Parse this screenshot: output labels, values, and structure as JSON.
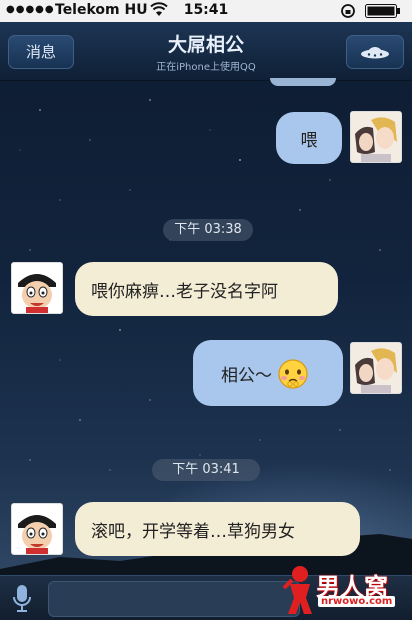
{
  "status_bar": {
    "signal": "●●●●●",
    "carrier": "Telekom HU",
    "time": "15:41"
  },
  "nav": {
    "back_label": "消息",
    "title": "大屌相公",
    "subtitle": "正在iPhone上使用QQ"
  },
  "messages": [
    {
      "direction": "out",
      "text": "喂"
    },
    {
      "type": "timestamp",
      "text": "下午 03:38"
    },
    {
      "direction": "in",
      "text": "喂你麻痹…老子没名字阿"
    },
    {
      "direction": "out",
      "text": "相公～",
      "emoji": "shy-face"
    },
    {
      "type": "timestamp",
      "text": "下午 03:41"
    },
    {
      "direction": "in",
      "text": "滚吧，开学等着…草狗男女"
    }
  ],
  "watermark": {
    "text": "男人窝",
    "url": "nrwowo.com"
  },
  "colors": {
    "outgoing_bubble": "#a9c6ec",
    "incoming_bubble": "#f4edd6",
    "nav_bar": "#1d3554"
  }
}
